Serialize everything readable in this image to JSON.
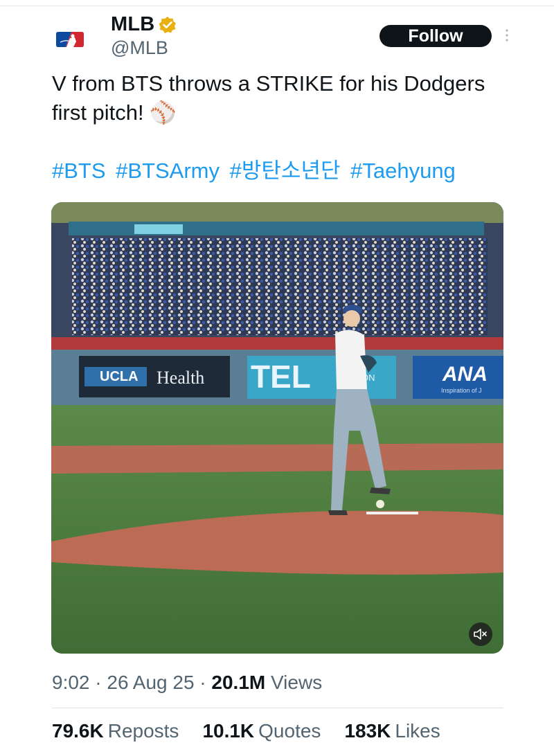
{
  "account": {
    "name": "MLB",
    "handle": "@MLB",
    "verified_badge_color": "#e8b010"
  },
  "follow_label": "Follow",
  "tweet": {
    "text": "V from BTS throws a STRIKE for his Dodgers first pitch! ⚾",
    "hashtags": [
      "#BTS",
      "#BTSArmy",
      "#방탄소년단",
      "#Taehyung"
    ]
  },
  "video": {
    "signage": [
      "UCLA",
      "Health",
      "TEL",
      "ON",
      "ANA",
      "Inspiration of J"
    ],
    "muted": true
  },
  "meta": {
    "time": "9:02",
    "date": "26 Aug 25",
    "views_count": "20.1M",
    "views_label": "Views",
    "sep": "·"
  },
  "stats": {
    "reposts_count": "79.6K",
    "reposts_label": "Reposts",
    "quotes_count": "10.1K",
    "quotes_label": "Quotes",
    "likes_count": "183K",
    "likes_label": "Likes"
  },
  "colors": {
    "link": "#1d9bf0",
    "text": "#0f1419",
    "secondary": "#536471",
    "button": "#0f1419"
  }
}
